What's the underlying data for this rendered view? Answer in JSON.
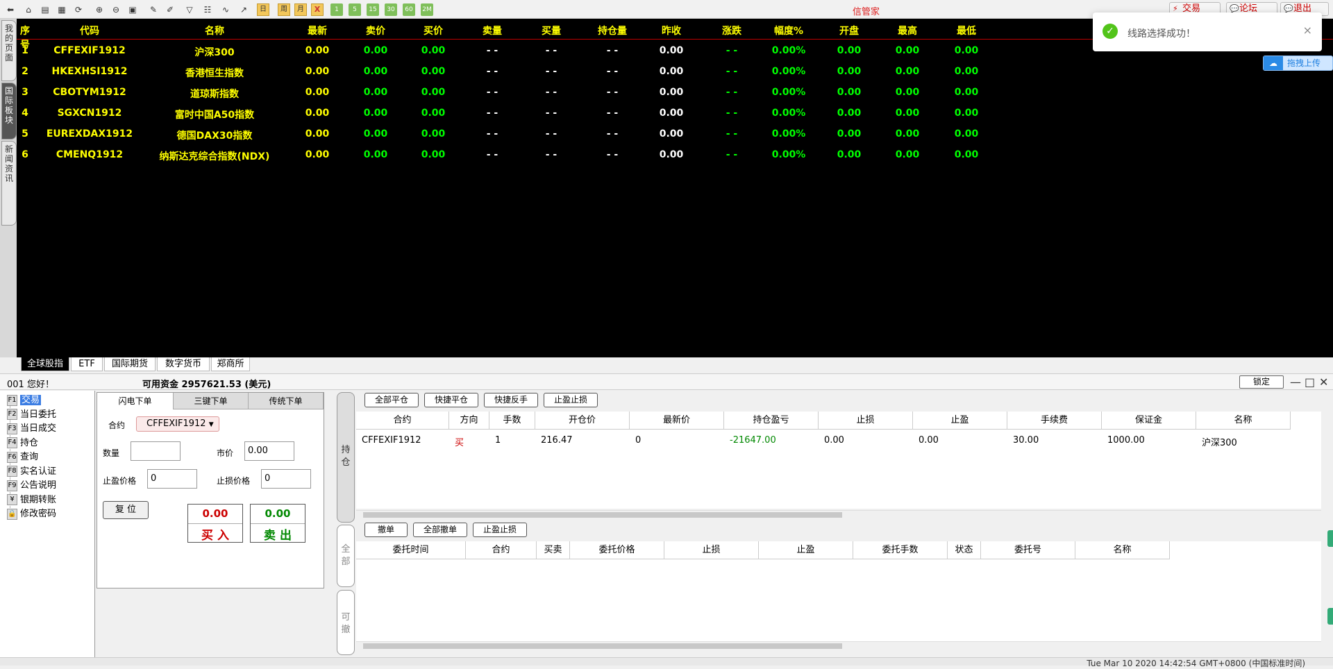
{
  "app_title": "信管家",
  "top_links": [
    {
      "label": "交易",
      "icon": "⚡"
    },
    {
      "label": "论坛",
      "icon": "💬"
    },
    {
      "label": "退出",
      "icon": "💬"
    }
  ],
  "toolbar_labels": {
    "day": "日",
    "week": "周",
    "month": "月",
    "x": "X",
    "m1": "1",
    "m5": "5",
    "m15": "15",
    "m30": "30",
    "m60": "60",
    "mon": "2M"
  },
  "left_tabs": [
    "我的页面",
    "国际板块",
    "新闻资讯"
  ],
  "quote_table": {
    "headers": [
      "序号",
      "代码",
      "名称",
      "最新",
      "卖价",
      "买价",
      "卖量",
      "买量",
      "持仓量",
      "昨收",
      "涨跌",
      "幅度%",
      "开盘",
      "最高",
      "最低"
    ],
    "rows": [
      [
        "1",
        "CFFEXIF1912",
        "沪深300",
        "0.00",
        "0.00",
        "0.00",
        "- -",
        "- -",
        "- -",
        "0.00",
        "- -",
        "0.00%",
        "0.00",
        "0.00",
        "0.00"
      ],
      [
        "2",
        "HKEXHSI1912",
        "香港恒生指数",
        "0.00",
        "0.00",
        "0.00",
        "- -",
        "- -",
        "- -",
        "0.00",
        "- -",
        "0.00%",
        "0.00",
        "0.00",
        "0.00"
      ],
      [
        "3",
        "CBOTYM1912",
        "道琼斯指数",
        "0.00",
        "0.00",
        "0.00",
        "- -",
        "- -",
        "- -",
        "0.00",
        "- -",
        "0.00%",
        "0.00",
        "0.00",
        "0.00"
      ],
      [
        "4",
        "SGXCN1912",
        "富时中国A50指数",
        "0.00",
        "0.00",
        "0.00",
        "- -",
        "- -",
        "- -",
        "0.00",
        "- -",
        "0.00%",
        "0.00",
        "0.00",
        "0.00"
      ],
      [
        "5",
        "EUREXDAX1912",
        "德国DAX30指数",
        "0.00",
        "0.00",
        "0.00",
        "- -",
        "- -",
        "- -",
        "0.00",
        "- -",
        "0.00%",
        "0.00",
        "0.00",
        "0.00"
      ],
      [
        "6",
        "CMENQ1912",
        "纳斯达克综合指数(NDX)",
        "0.00",
        "0.00",
        "0.00",
        "- -",
        "- -",
        "- -",
        "0.00",
        "- -",
        "0.00%",
        "0.00",
        "0.00",
        "0.00"
      ]
    ]
  },
  "toast": {
    "message": "线路选择成功！",
    "close": "×",
    "check": "✓"
  },
  "upload": {
    "label": "拖拽上传",
    "icon": "☁"
  },
  "bottom_tabs": [
    "全球股指",
    "ETF",
    "国际期货",
    "数字货币",
    "郑商所"
  ],
  "status": {
    "greeting": "001 您好！",
    "funds": "可用资金 2957621.53 (美元)",
    "lock": "锁定"
  },
  "window_controls": {
    "min": "—",
    "max": "□",
    "close": "✕"
  },
  "nav_tree": [
    {
      "key": "F1",
      "label": "交易"
    },
    {
      "key": "F2",
      "label": "当日委托"
    },
    {
      "key": "F3",
      "label": "当日成交"
    },
    {
      "key": "F4",
      "label": "持仓"
    },
    {
      "key": "F6",
      "label": "查询"
    },
    {
      "key": "F8",
      "label": "实名认证"
    },
    {
      "key": "F9",
      "label": "公告说明"
    },
    {
      "key": "¥",
      "label": "银期转账"
    },
    {
      "key": "🔒",
      "label": "修改密码"
    }
  ],
  "order_panel": {
    "tabs": [
      "闪电下单",
      "三键下单",
      "传统下单"
    ],
    "contract_label": "合约",
    "contract_value": "CFFEXIF1912",
    "qty_label": "数量",
    "qty_value": "",
    "market_label": "市价",
    "market_value": "0.00",
    "tp_label": "止盈价格",
    "tp_value": "0",
    "sl_label": "止损价格",
    "sl_value": "0",
    "reset": "复 位",
    "buy_price": "0.00",
    "buy_label": "买 入",
    "sell_price": "0.00",
    "sell_label": "卖 出"
  },
  "side_tabs": [
    "持仓",
    "全部",
    "可撤"
  ],
  "positions": {
    "actions": [
      "全部平仓",
      "快捷平仓",
      "快捷反手",
      "止盈止损"
    ],
    "headers": [
      "合约",
      "方向",
      "手数",
      "开仓价",
      "最新价",
      "持仓盈亏",
      "止损",
      "止盈",
      "手续费",
      "保证金",
      "名称"
    ],
    "rows": [
      [
        "CFFEXIF1912",
        "买",
        "1",
        "216.47",
        "0",
        "-21647.00",
        "0.00",
        "0.00",
        "30.00",
        "1000.00",
        "沪深300"
      ]
    ]
  },
  "orders": {
    "actions": [
      "撤单",
      "全部撤单",
      "止盈止损"
    ],
    "headers": [
      "委托时间",
      "合约",
      "买卖",
      "委托价格",
      "止损",
      "止盈",
      "委托手数",
      "状态",
      "委托号",
      "名称"
    ]
  },
  "footer_time": "Tue Mar 10 2020 14:42:54 GMT+0800 (中国标准时间)",
  "colors": {
    "quote_bg": "#000000",
    "header_text": "#ffff00",
    "positive": "#00ff00",
    "buy": "#cc0000",
    "sell": "#008800"
  }
}
